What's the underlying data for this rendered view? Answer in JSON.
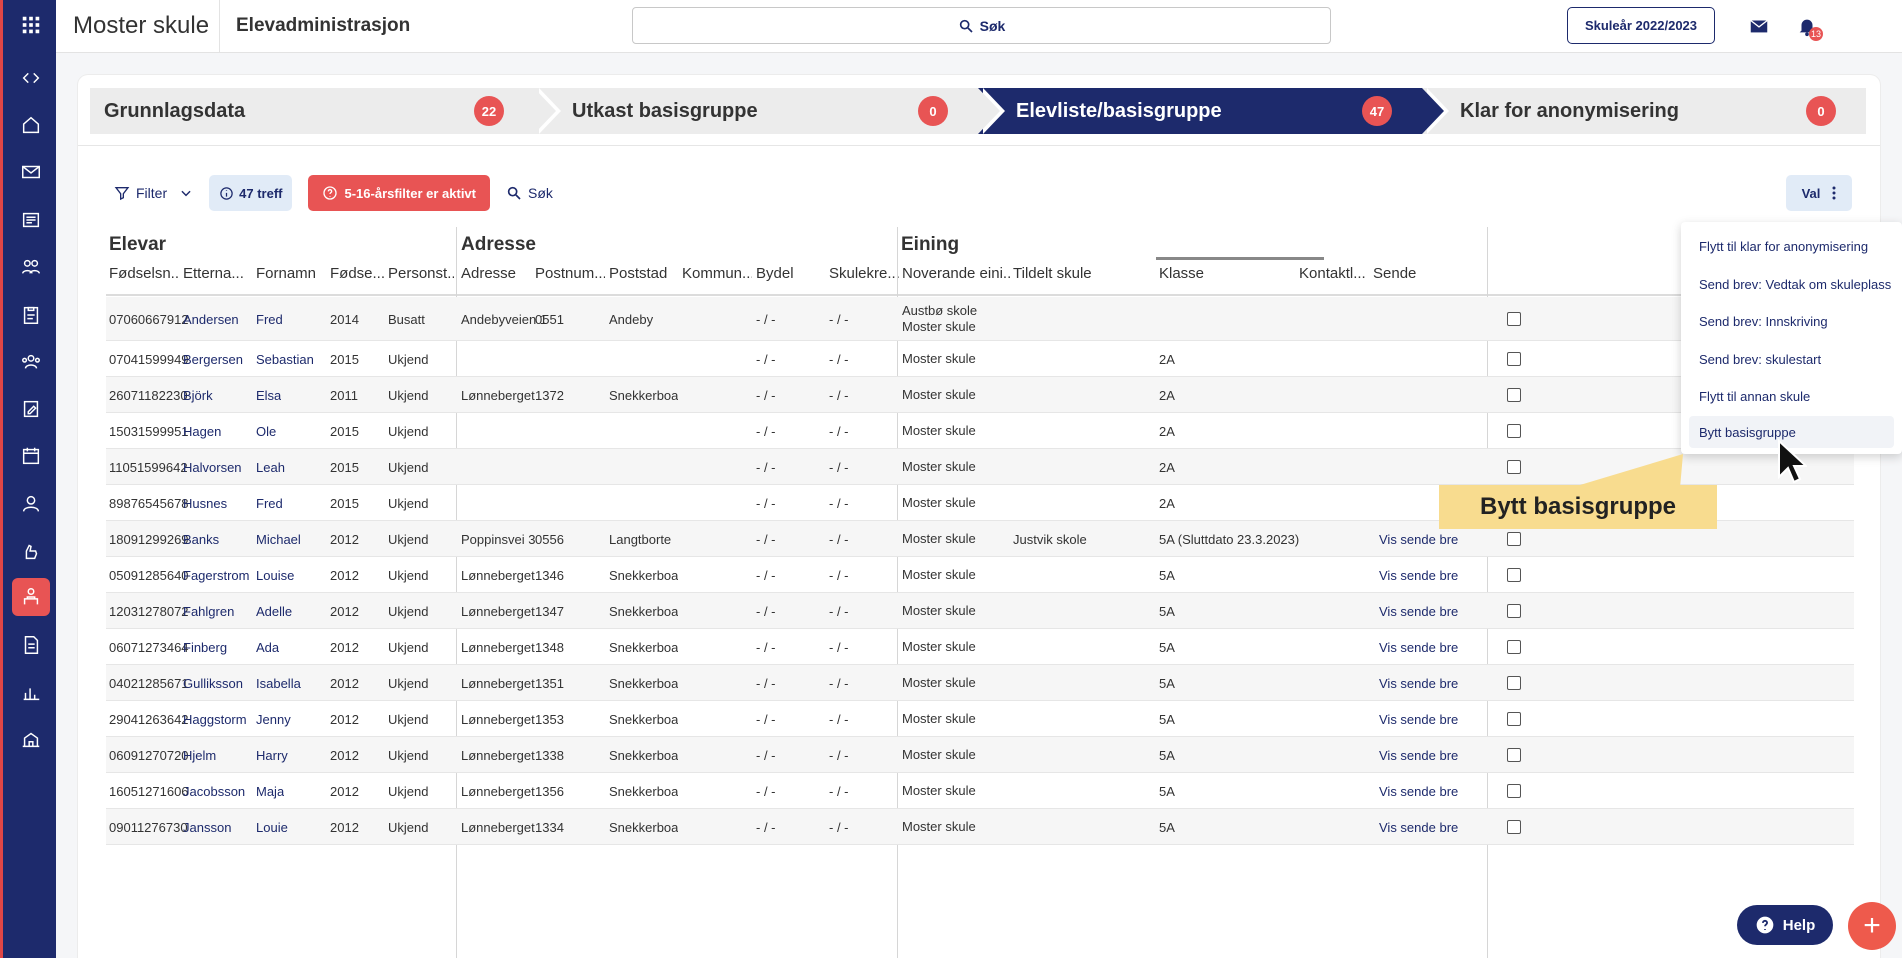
{
  "header": {
    "brand": "Moster skule",
    "app_title": "Elevadministrasjon",
    "search_label": "Søk",
    "school_year": "Skuleår 2022/2023",
    "notification_count": "13"
  },
  "steps": [
    {
      "label": "Grunnlagsdata",
      "count": "22"
    },
    {
      "label": "Utkast basisgruppe",
      "count": "0"
    },
    {
      "label": "Elevliste/basisgruppe",
      "count": "47"
    },
    {
      "label": "Klar for anonymisering",
      "count": "0"
    }
  ],
  "toolbar": {
    "filter_label": "Filter",
    "hits_label": "47 treff",
    "alert_label": "5-16-årsfilter er aktivt",
    "search_label": "Søk",
    "val_label": "Val"
  },
  "groups": {
    "elevar": "Elevar",
    "adresse": "Adresse",
    "eining": "Eining"
  },
  "columns": [
    "Fødselsn...",
    "Etterna...",
    "Fornamn",
    "Fødse...",
    "Personst...",
    "Adresse",
    "Postnum...",
    "Poststad",
    "Kommun...",
    "Bydel",
    "Skulekre...",
    "Noverande eini...",
    "Tildelt skule",
    "Klasse",
    "Kontaktl...",
    "Sende"
  ],
  "rows": [
    {
      "fnr": "07060667912",
      "etternamn": "Andersen",
      "fornamn": "Fred",
      "aar": "2014",
      "status": "Busatt",
      "adresse": "Andebyveien 1",
      "postnr": "0551",
      "poststad": "Andeby",
      "bydel": "- / -",
      "skulekrets": "- / -",
      "eining1": "Austbø skole",
      "eining2": "Moster skule",
      "tildelt": "",
      "klasse": "",
      "vis": ""
    },
    {
      "fnr": "07041599949",
      "etternamn": "Bergersen",
      "fornamn": "Sebastian",
      "aar": "2015",
      "status": "Ukjend",
      "adresse": "",
      "postnr": "",
      "poststad": "",
      "bydel": "- / -",
      "skulekrets": "- / -",
      "eining1": "Moster skule",
      "eining2": "",
      "tildelt": "",
      "klasse": "2A",
      "vis": ""
    },
    {
      "fnr": "26071182230",
      "etternamn": "Björk",
      "fornamn": "Elsa",
      "aar": "2011",
      "status": "Ukjend",
      "adresse": "Lønneberget",
      "postnr": "1372",
      "poststad": "Snekkerboa",
      "bydel": "- / -",
      "skulekrets": "- / -",
      "eining1": "Moster skule",
      "eining2": "",
      "tildelt": "",
      "klasse": "2A",
      "vis": ""
    },
    {
      "fnr": "15031599951",
      "etternamn": "Hagen",
      "fornamn": "Ole",
      "aar": "2015",
      "status": "Ukjend",
      "adresse": "",
      "postnr": "",
      "poststad": "",
      "bydel": "- / -",
      "skulekrets": "- / -",
      "eining1": "Moster skule",
      "eining2": "",
      "tildelt": "",
      "klasse": "2A",
      "vis": ""
    },
    {
      "fnr": "11051599642",
      "etternamn": "Halvorsen",
      "fornamn": "Leah",
      "aar": "2015",
      "status": "Ukjend",
      "adresse": "",
      "postnr": "",
      "poststad": "",
      "bydel": "- / -",
      "skulekrets": "- / -",
      "eining1": "Moster skule",
      "eining2": "",
      "tildelt": "",
      "klasse": "2A",
      "vis": ""
    },
    {
      "fnr": "89876545678",
      "etternamn": "Husnes",
      "fornamn": "Fred",
      "aar": "2015",
      "status": "Ukjend",
      "adresse": "",
      "postnr": "",
      "poststad": "",
      "bydel": "- / -",
      "skulekrets": "- / -",
      "eining1": "Moster skule",
      "eining2": "",
      "tildelt": "",
      "klasse": "2A",
      "vis": ""
    },
    {
      "fnr": "18091299269",
      "etternamn": "Banks",
      "fornamn": "Michael",
      "aar": "2012",
      "status": "Ukjend",
      "adresse": "Poppinsvei 3",
      "postnr": "0556",
      "poststad": "Langtborte",
      "bydel": "- / -",
      "skulekrets": "- / -",
      "eining1": "Moster skule",
      "eining2": "",
      "tildelt": "Justvik skole",
      "klasse": "5A (Sluttdato 23.3.2023)",
      "vis": "Vis sende brev"
    },
    {
      "fnr": "05091285640",
      "etternamn": "Fagerstrom",
      "fornamn": "Louise",
      "aar": "2012",
      "status": "Ukjend",
      "adresse": "Lønneberget",
      "postnr": "1346",
      "poststad": "Snekkerboa",
      "bydel": "- / -",
      "skulekrets": "- / -",
      "eining1": "Moster skule",
      "eining2": "",
      "tildelt": "",
      "klasse": "5A",
      "vis": "Vis sende brev"
    },
    {
      "fnr": "12031278072",
      "etternamn": "Fahlgren",
      "fornamn": "Adelle",
      "aar": "2012",
      "status": "Ukjend",
      "adresse": "Lønneberget",
      "postnr": "1347",
      "poststad": "Snekkerboa",
      "bydel": "- / -",
      "skulekrets": "- / -",
      "eining1": "Moster skule",
      "eining2": "",
      "tildelt": "",
      "klasse": "5A",
      "vis": "Vis sende brev"
    },
    {
      "fnr": "06071273464",
      "etternamn": "Finberg",
      "fornamn": "Ada",
      "aar": "2012",
      "status": "Ukjend",
      "adresse": "Lønneberget",
      "postnr": "1348",
      "poststad": "Snekkerboa",
      "bydel": "- / -",
      "skulekrets": "- / -",
      "eining1": "Moster skule",
      "eining2": "",
      "tildelt": "",
      "klasse": "5A",
      "vis": "Vis sende brev"
    },
    {
      "fnr": "04021285671",
      "etternamn": "Gulliksson",
      "fornamn": "Isabella",
      "aar": "2012",
      "status": "Ukjend",
      "adresse": "Lønneberget",
      "postnr": "1351",
      "poststad": "Snekkerboa",
      "bydel": "- / -",
      "skulekrets": "- / -",
      "eining1": "Moster skule",
      "eining2": "",
      "tildelt": "",
      "klasse": "5A",
      "vis": "Vis sende brev"
    },
    {
      "fnr": "29041263642",
      "etternamn": "Haggstorm",
      "fornamn": "Jenny",
      "aar": "2012",
      "status": "Ukjend",
      "adresse": "Lønneberget",
      "postnr": "1353",
      "poststad": "Snekkerboa",
      "bydel": "- / -",
      "skulekrets": "- / -",
      "eining1": "Moster skule",
      "eining2": "",
      "tildelt": "",
      "klasse": "5A",
      "vis": "Vis sende brev"
    },
    {
      "fnr": "06091270720",
      "etternamn": "Hjelm",
      "fornamn": "Harry",
      "aar": "2012",
      "status": "Ukjend",
      "adresse": "Lønneberget",
      "postnr": "1338",
      "poststad": "Snekkerboa",
      "bydel": "- / -",
      "skulekrets": "- / -",
      "eining1": "Moster skule",
      "eining2": "",
      "tildelt": "",
      "klasse": "5A",
      "vis": "Vis sende brev"
    },
    {
      "fnr": "16051271606",
      "etternamn": "Jacobsson",
      "fornamn": "Maja",
      "aar": "2012",
      "status": "Ukjend",
      "adresse": "Lønneberget",
      "postnr": "1356",
      "poststad": "Snekkerboa",
      "bydel": "- / -",
      "skulekrets": "- / -",
      "eining1": "Moster skule",
      "eining2": "",
      "tildelt": "",
      "klasse": "5A",
      "vis": "Vis sende brev"
    },
    {
      "fnr": "09011276730",
      "etternamn": "Jansson",
      "fornamn": "Louie",
      "aar": "2012",
      "status": "Ukjend",
      "adresse": "Lønneberget",
      "postnr": "1334",
      "poststad": "Snekkerboa",
      "bydel": "- / -",
      "skulekrets": "- / -",
      "eining1": "Moster skule",
      "eining2": "",
      "tildelt": "",
      "klasse": "5A",
      "vis": "Vis sende brev"
    }
  ],
  "menu": {
    "items": [
      "Flytt til klar for anonymisering",
      "Send brev: Vedtak om skuleplass",
      "Send brev: Innskriving",
      "Send brev: skulestart",
      "Flytt til annan skule",
      "Bytt basisgruppe"
    ]
  },
  "callout": "Bytt basisgruppe",
  "help_label": "Help",
  "colors": {
    "navy": "#1d2a6c",
    "accent_red": "#e85454",
    "callout_yellow": "#f8dc8f"
  },
  "icons": [
    "apps-grid-icon",
    "collapse-icon",
    "home-icon",
    "mail-icon",
    "news-icon",
    "users-icon",
    "clipboard-icon",
    "group-icon",
    "edit-doc-icon",
    "calendar-icon",
    "person-icon",
    "hand-icon",
    "student-icon",
    "document-icon",
    "chart-icon",
    "school-icon"
  ]
}
